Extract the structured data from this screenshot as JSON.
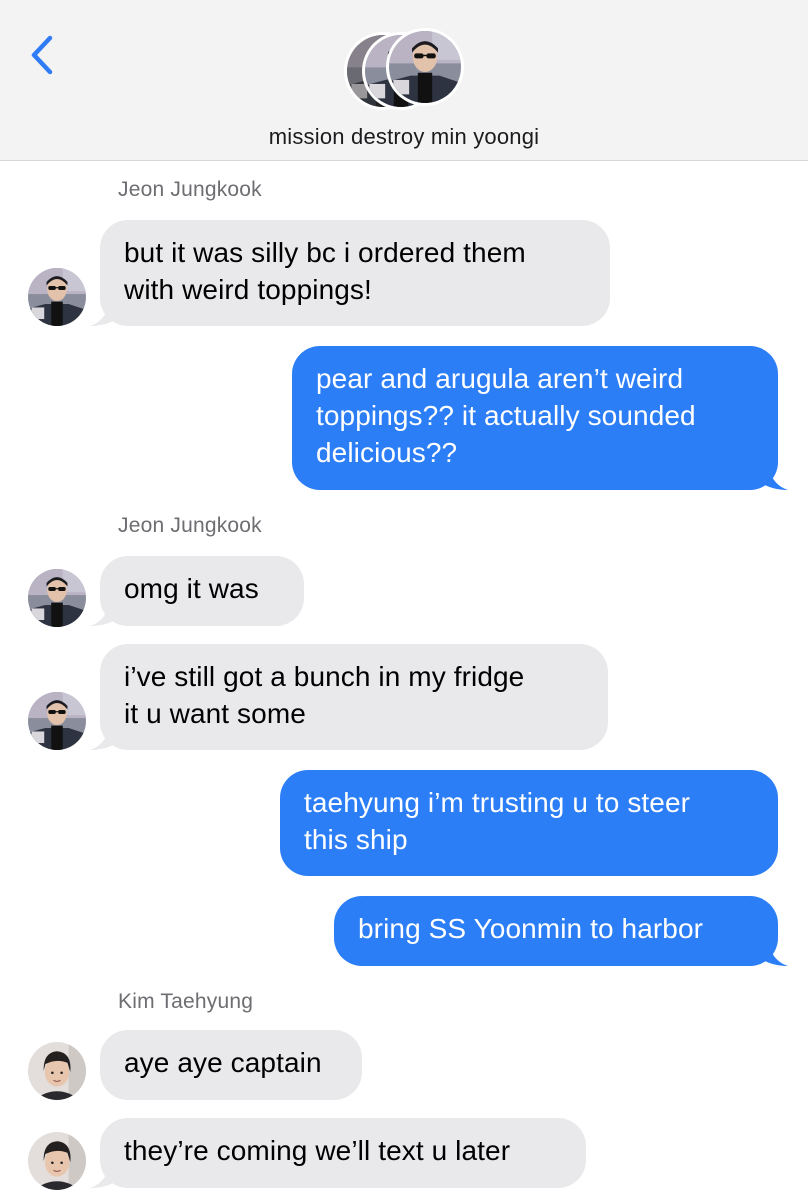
{
  "header": {
    "back_icon": "chevron-left-icon",
    "title": "mission destroy min yoongi",
    "accent_color": "#2f7cf6"
  },
  "colors": {
    "sent_bubble": "#2c7ef7",
    "received_bubble": "#e9e9eb",
    "header_bg": "#f3f3f4"
  },
  "messages": [
    {
      "sender": "Jeon Jungkook"
    },
    {
      "text_lines": [
        "but it was silly bc i ordered them",
        "with weird toppings!"
      ]
    },
    {
      "text_lines": [
        "pear and arugula aren’t weird",
        "toppings?? it actually sounded",
        "delicious??"
      ]
    },
    {
      "sender": "Jeon Jungkook"
    },
    {
      "text_lines": [
        "omg it was"
      ]
    },
    {
      "text_lines": [
        "i’ve still got a bunch in my fridge",
        "it u want some"
      ]
    },
    {
      "text_lines": [
        "taehyung i’m trusting u to steer",
        "this ship"
      ]
    },
    {
      "text_lines": [
        "bring SS Yoonmin to harbor"
      ]
    },
    {
      "sender": "Kim Taehyung"
    },
    {
      "text_lines": [
        "aye aye captain"
      ]
    },
    {
      "text_lines": [
        "they’re coming we’ll text u later"
      ]
    }
  ]
}
